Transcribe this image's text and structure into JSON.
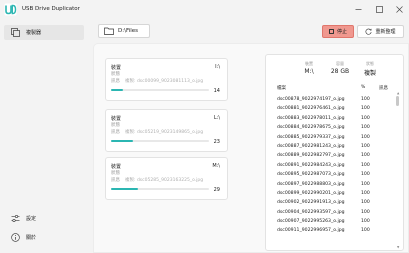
{
  "app": {
    "title": "USB Drive Duplicator"
  },
  "sidebar": {
    "items": [
      {
        "label": "複製器",
        "icon": "copy-icon",
        "active": true
      },
      {
        "label": "設定",
        "icon": "settings-sliders-icon"
      },
      {
        "label": "關於",
        "icon": "info-icon"
      }
    ]
  },
  "toolbar": {
    "path_label": "D:\\Files",
    "stop_label": "停止",
    "refresh_label": "重新整理"
  },
  "devices": [
    {
      "title": "裝置",
      "drive": "I:\\",
      "status_key": "狀態",
      "status_value": "",
      "info_key": "訊息",
      "info_value": "複製: dsc00099_9023081113_o.jpg",
      "count": "14",
      "progress": 0.12
    },
    {
      "title": "裝置",
      "drive": "L:\\",
      "status_key": "狀態",
      "status_value": "",
      "info_key": "訊息",
      "info_value": "複製: dsc05219_9023149865_o.jpg",
      "count": "23",
      "progress": 0.22
    },
    {
      "title": "裝置",
      "drive": "M:\\",
      "status_key": "狀態",
      "status_value": "",
      "info_key": "訊息",
      "info_value": "複製: dsc05285_9023163225_o.jpg",
      "count": "29",
      "progress": 0.28
    }
  ],
  "panel": {
    "stats": [
      {
        "key": "裝置",
        "value": "M:\\"
      },
      {
        "key": "容量",
        "value": "28 GB"
      },
      {
        "key": "狀態",
        "value": "複製"
      }
    ],
    "headers": {
      "file": "檔案",
      "percent": "%",
      "message": "訊息"
    },
    "rows": [
      {
        "file": "dsc00878_9022974197_o.jpg",
        "percent": "100"
      },
      {
        "file": "dsc00881_9022976461_o.jpg",
        "percent": "100"
      },
      {
        "file": "dsc00883_9022978011_o.jpg",
        "percent": "100"
      },
      {
        "file": "dsc00884_9022978675_o.jpg",
        "percent": "100"
      },
      {
        "file": "dsc00885_9022979337_o.jpg",
        "percent": "100"
      },
      {
        "file": "dsc00887_9022981243_o.jpg",
        "percent": "100"
      },
      {
        "file": "dsc00889_9022982797_o.jpg",
        "percent": "100"
      },
      {
        "file": "dsc00891_9022984243_o.jpg",
        "percent": "100"
      },
      {
        "file": "dsc00895_9022987073_o.jpg",
        "percent": "100"
      },
      {
        "file": "dsc00897_9022988803_o.jpg",
        "percent": "100"
      },
      {
        "file": "dsc00899_9022990201_o.jpg",
        "percent": "100"
      },
      {
        "file": "dsc00902_9022991913_o.jpg",
        "percent": "100"
      },
      {
        "file": "dsc00904_9022993597_o.jpg",
        "percent": "100"
      },
      {
        "file": "dsc00907_9022995263_o.jpg",
        "percent": "100"
      },
      {
        "file": "dsc00911_9022996957_o.jpg",
        "percent": "100"
      }
    ]
  },
  "colors": {
    "accent": "#2bb6b2",
    "stop": "#f0988f",
    "logo": "#2bb6b2"
  }
}
